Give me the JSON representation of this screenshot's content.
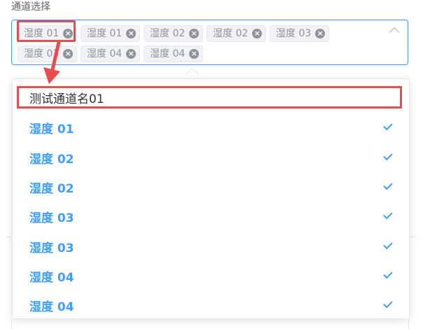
{
  "form": {
    "label": "通道选择"
  },
  "select": {
    "tags": [
      {
        "label": "湿度 01"
      },
      {
        "label": "湿度 01"
      },
      {
        "label": "湿度 02"
      },
      {
        "label": "湿度 02"
      },
      {
        "label": "湿度 03"
      },
      {
        "label": "湿度 03"
      },
      {
        "label": "湿度 04"
      },
      {
        "label": "湿度 04"
      }
    ],
    "close_glyph": "×"
  },
  "dropdown": {
    "group_title": "测试通道名01",
    "options": [
      {
        "label": "湿度 01",
        "selected": true
      },
      {
        "label": "湿度 02",
        "selected": true
      },
      {
        "label": "湿度 02",
        "selected": true
      },
      {
        "label": "湿度 03",
        "selected": true
      },
      {
        "label": "湿度 03",
        "selected": true
      },
      {
        "label": "湿度 04",
        "selected": true
      },
      {
        "label": "湿度 04",
        "selected": true
      }
    ]
  },
  "colors": {
    "accent": "#409eff",
    "highlight": "#e84c4c",
    "tag_bg": "#f0f2f5",
    "tag_text": "#909399"
  }
}
